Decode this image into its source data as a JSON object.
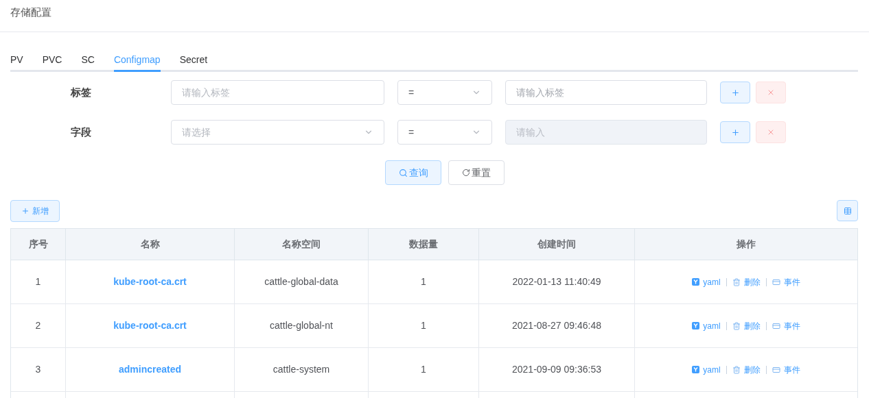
{
  "page_title": "存储配置",
  "tabs": [
    {
      "label": "PV",
      "selected": false
    },
    {
      "label": "PVC",
      "selected": false
    },
    {
      "label": "SC",
      "selected": false
    },
    {
      "label": "Configmap",
      "selected": true
    },
    {
      "label": "Secret",
      "selected": false
    }
  ],
  "filters": [
    {
      "label": "标签",
      "key_field": {
        "kind": "input",
        "placeholder": "请输入标签"
      },
      "operator": "=",
      "value_field": {
        "placeholder": "请输入标签",
        "disabled": false
      }
    },
    {
      "label": "字段",
      "key_field": {
        "kind": "select",
        "placeholder": "请选择"
      },
      "operator": "=",
      "value_field": {
        "placeholder": "请输入",
        "disabled": true
      }
    }
  ],
  "query_button": "查询",
  "reset_button": "重置",
  "add_button": "新增",
  "table": {
    "columns": [
      "序号",
      "名称",
      "名称空间",
      "数据量",
      "创建时间",
      "操作"
    ],
    "rows": [
      {
        "index": "1",
        "name": "kube-root-ca.crt",
        "namespace": "cattle-global-data",
        "data_count": "1",
        "created": "2022-01-13 11:40:49",
        "actions": [
          "yaml",
          "删除",
          "事件"
        ]
      },
      {
        "index": "2",
        "name": "kube-root-ca.crt",
        "namespace": "cattle-global-nt",
        "data_count": "1",
        "created": "2021-08-27 09:46:48",
        "actions": [
          "yaml",
          "删除",
          "事件"
        ]
      },
      {
        "index": "3",
        "name": "admincreated",
        "namespace": "cattle-system",
        "data_count": "1",
        "created": "2021-09-09 09:36:53",
        "actions": [
          "yaml",
          "删除",
          "事件"
        ]
      }
    ]
  }
}
